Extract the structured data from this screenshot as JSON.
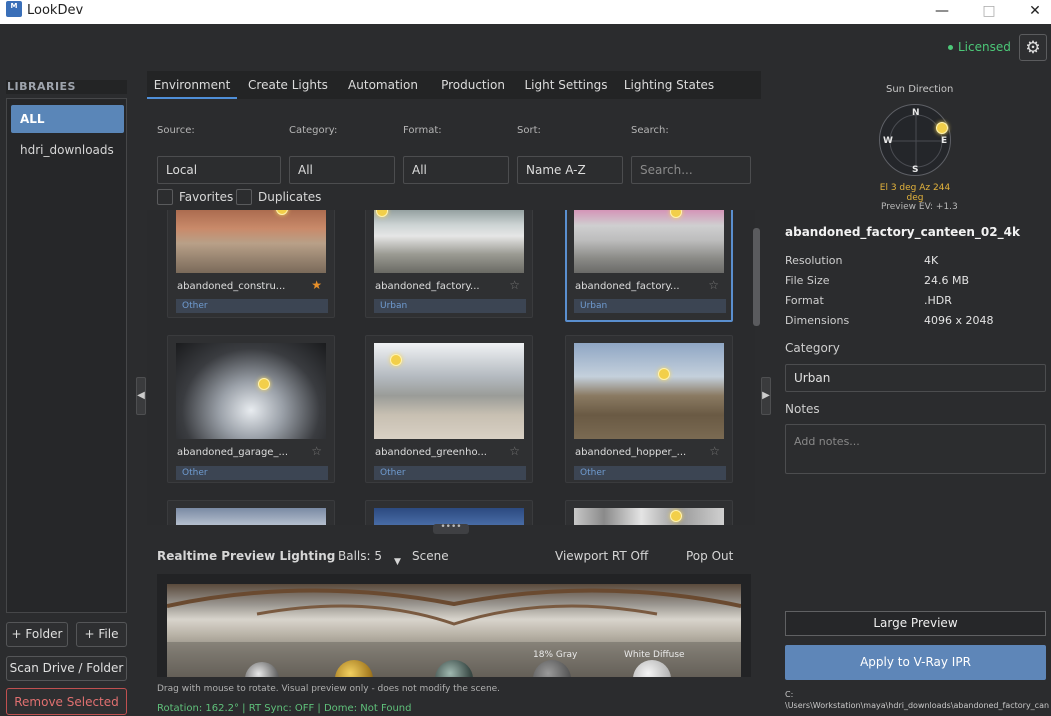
{
  "window": {
    "title": "LookDev",
    "icon_text": "M",
    "minimize_glyph": "—",
    "maximize_glyph": "□",
    "close_glyph": "✕"
  },
  "header": {
    "license_status": "Licensed",
    "license_color": "#4cc878",
    "settings_icon": "gear-icon"
  },
  "sidebar": {
    "title": "LIBRARIES",
    "items": [
      {
        "label": "ALL",
        "selected": true
      },
      {
        "label": "hdri_downloads",
        "selected": false
      }
    ],
    "add_folder_label": "+ Folder",
    "add_file_label": "+ File",
    "scan_label": "Scan Drive / Folder",
    "remove_label": "Remove Selected"
  },
  "tabs": [
    {
      "label": "Environment",
      "selected": true
    },
    {
      "label": "Create Lights"
    },
    {
      "label": "Automation"
    },
    {
      "label": "Production"
    },
    {
      "label": "Light Settings"
    },
    {
      "label": "Lighting States"
    }
  ],
  "filters": {
    "source": {
      "label": "Source:",
      "value": "Local"
    },
    "category": {
      "label": "Category:",
      "value": "All"
    },
    "format": {
      "label": "Format:",
      "value": "All"
    },
    "sort": {
      "label": "Sort:",
      "value": "Name A-Z"
    },
    "search": {
      "label": "Search:",
      "placeholder": "Search..."
    },
    "favorites_label": "Favorites",
    "duplicates_label": "Duplicates"
  },
  "grid": {
    "items": [
      {
        "name": "abandoned_constru...",
        "tag": "Other",
        "favorite": true
      },
      {
        "name": "abandoned_factory...",
        "tag": "Urban",
        "favorite": false
      },
      {
        "name": "abandoned_factory...",
        "tag": "Urban",
        "favorite": false,
        "selected": true
      },
      {
        "name": "abandoned_garage_...",
        "tag": "Other",
        "favorite": false
      },
      {
        "name": "abandoned_greenho...",
        "tag": "Other",
        "favorite": false
      },
      {
        "name": "abandoned_hopper_...",
        "tag": "Other",
        "favorite": false
      }
    ],
    "star_glyph": "★",
    "star_empty_glyph": "☆"
  },
  "preview": {
    "title": "Realtime Preview Lighting",
    "balls": "Balls: 5",
    "scene": "Scene",
    "viewport_rt": "Viewport RT Off",
    "pop_out": "Pop Out",
    "ball_labels": [
      "18% Gray",
      "White Diffuse"
    ],
    "note": "Drag with mouse to rotate. Visual preview only - does not modify the scene.",
    "status": "Rotation: 162.2° | RT Sync: OFF | Dome: Not Found"
  },
  "details": {
    "sun_direction_label": "Sun Direction",
    "compass": {
      "n": "N",
      "s": "S",
      "e": "E",
      "w": "W"
    },
    "sun_info": "El 3 deg  Az 244 deg",
    "preview_ev": "Preview EV: +1.3",
    "title": "abandoned_factory_canteen_02_4k",
    "properties": [
      {
        "key": "Resolution",
        "value": "4K"
      },
      {
        "key": "File Size",
        "value": "24.6 MB"
      },
      {
        "key": "Format",
        "value": ".HDR"
      },
      {
        "key": "Dimensions",
        "value": "4096 x 2048"
      }
    ],
    "category_label": "Category",
    "category_value": "Urban",
    "notes_label": "Notes",
    "notes_placeholder": "Add notes...",
    "large_preview_label": "Large Preview",
    "apply_label": "Apply to V-Ray IPR",
    "path_line1": "C:",
    "path_line2": "\\Users\\Workstation\\maya\\hdri_downloads\\abandoned_factory_can"
  }
}
